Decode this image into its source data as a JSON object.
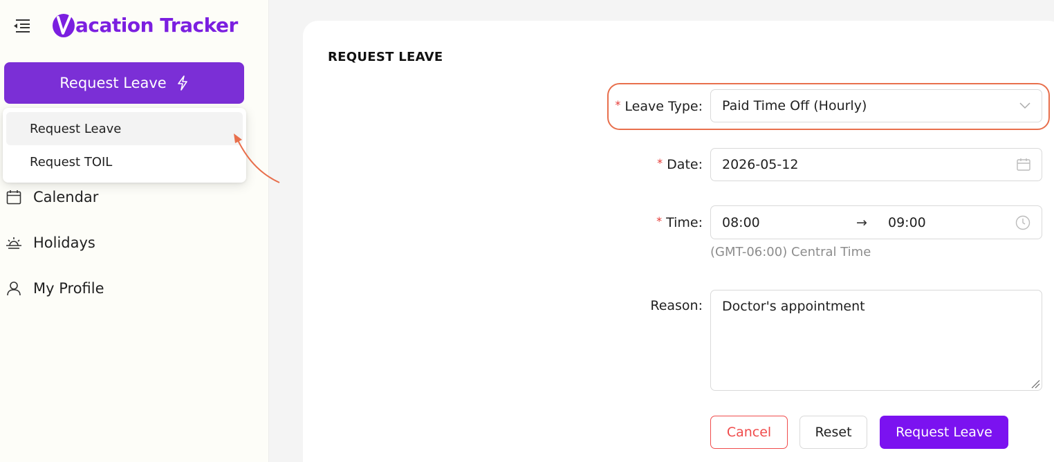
{
  "app": {
    "logo_text": "acation Tracker",
    "brand_color": "#7b1fe0"
  },
  "sidebar": {
    "primary_button_label": "Request Leave",
    "dropdown": [
      {
        "label": "Request Leave",
        "active": true
      },
      {
        "label": "Request TOIL",
        "active": false
      }
    ],
    "nav": [
      {
        "label": "Calendar",
        "icon": "calendar-icon"
      },
      {
        "label": "Holidays",
        "icon": "sunrise-icon"
      },
      {
        "label": "My Profile",
        "icon": "user-icon"
      }
    ]
  },
  "form": {
    "title": "REQUEST LEAVE",
    "leave_type": {
      "label": "Leave Type",
      "value": "Paid Time Off (Hourly)"
    },
    "date": {
      "label": "Date",
      "value": "2026-05-12"
    },
    "time": {
      "label": "Time",
      "start": "08:00",
      "separator": "→",
      "end": "09:00",
      "timezone_hint": "(GMT-06:00) Central Time"
    },
    "reason": {
      "label": "Reason",
      "value": "Doctor's appointment"
    },
    "buttons": {
      "cancel": "Cancel",
      "reset": "Reset",
      "submit": "Request Leave"
    }
  },
  "colors": {
    "accent": "#7b12f0",
    "danger": "#f04b4b",
    "highlight": "#e86f4c"
  }
}
